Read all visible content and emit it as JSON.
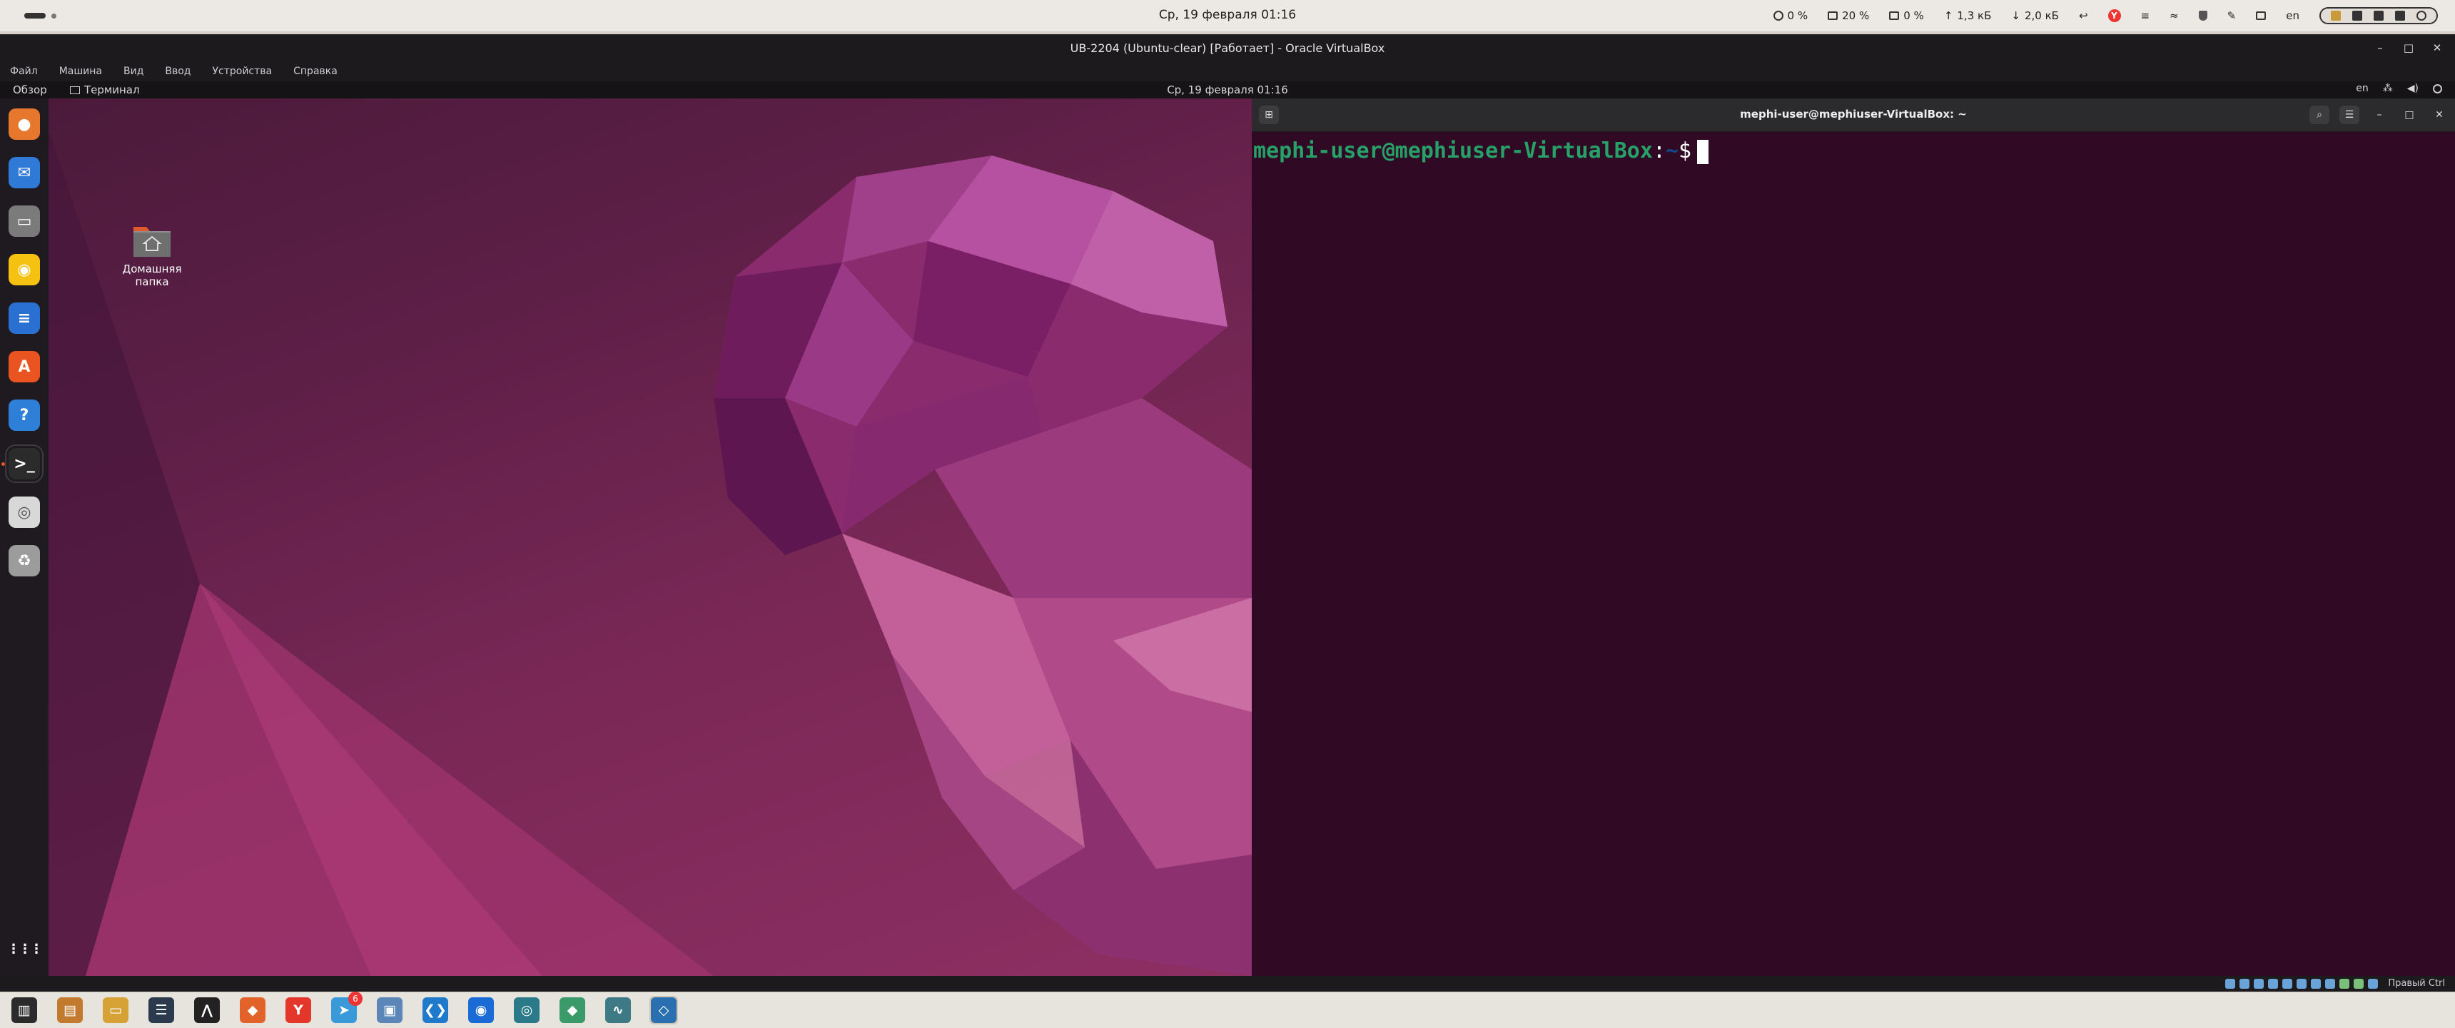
{
  "host": {
    "clock": "Ср, 19 февраля  01:16",
    "tray": {
      "cpu": "0 %",
      "memory": "20 %",
      "swap": "0 %",
      "upload": "1,3 кБ",
      "download": "2,0 кБ",
      "layout": "en",
      "icons": [
        "cpu-icon",
        "memory-icon",
        "swap-icon",
        "upload-arrow-icon",
        "download-arrow-icon",
        "back-arrow-icon",
        "yandex-icon",
        "notes-icon",
        "wifi-icon",
        "shield-icon",
        "pin-icon",
        "clipboard-icon"
      ]
    },
    "status_cluster_icons": [
      "mic-icon",
      "screen-icon",
      "bluetooth-icon",
      "volume-icon",
      "power-icon"
    ],
    "taskbar": [
      {
        "name": "files-icon",
        "color": "#2b2b2b",
        "glyph": "▥"
      },
      {
        "name": "archive-icon",
        "color": "#c17a2e",
        "glyph": "▤"
      },
      {
        "name": "folder-icon",
        "color": "#d6a235",
        "glyph": "▭"
      },
      {
        "name": "notes-app-icon",
        "color": "#2c3a4d",
        "glyph": "☰"
      },
      {
        "name": "terminal-alt-icon",
        "color": "#222222",
        "glyph": "⋀"
      },
      {
        "name": "gitlab-icon",
        "color": "#e2632a",
        "glyph": "◆"
      },
      {
        "name": "yandex-browser-icon",
        "color": "#e4362b",
        "glyph": "Y"
      },
      {
        "name": "telegram-icon",
        "color": "#3a9ad9",
        "glyph": "➤",
        "badge": "6"
      },
      {
        "name": "virtualbox-manager-icon",
        "color": "#5b86b7",
        "glyph": "▣"
      },
      {
        "name": "vscode-icon",
        "color": "#1f7acc",
        "glyph": "❮❯"
      },
      {
        "name": "chat-icon",
        "color": "#1b6bd6",
        "glyph": "◉"
      },
      {
        "name": "mixer-icon",
        "color": "#2a7a8a",
        "glyph": "◎"
      },
      {
        "name": "toolbox-icon",
        "color": "#3a9a6a",
        "glyph": "◆"
      },
      {
        "name": "monitor-icon",
        "color": "#3d7a85",
        "glyph": "∿"
      },
      {
        "name": "virtualbox-vm-icon",
        "color": "#2a6fb0",
        "glyph": "◇",
        "active": true
      }
    ]
  },
  "vbox": {
    "title": "UB-2204 (Ubuntu-clear) [Работает] - Oracle VirtualBox",
    "menu": [
      "Файл",
      "Машина",
      "Вид",
      "Ввод",
      "Устройства",
      "Справка"
    ],
    "hostkey_label": "Правый Ctrl"
  },
  "guest": {
    "overview": "Обзор",
    "active_app": "Терминал",
    "clock": "Ср, 19 февраля  01:16",
    "layout": "en",
    "desktop_icon_label": "Домашняя папка",
    "dock": [
      {
        "name": "firefox-icon",
        "color": "#e8772e",
        "glyph": "●"
      },
      {
        "name": "thunderbird-icon",
        "color": "#2f7ad7",
        "glyph": "✉"
      },
      {
        "name": "files-icon",
        "color": "#7b7b7b",
        "glyph": "▭"
      },
      {
        "name": "rhythmbox-icon",
        "color": "#f5c211",
        "glyph": "◉"
      },
      {
        "name": "writer-icon",
        "color": "#2a6fd2",
        "glyph": "≡"
      },
      {
        "name": "software-center-icon",
        "color": "#e95420",
        "glyph": "A"
      },
      {
        "name": "help-icon",
        "color": "#2d7fd7",
        "glyph": "?"
      },
      {
        "name": "terminal-icon",
        "color": "#2b2b2b",
        "glyph": ">_",
        "active": true
      },
      {
        "name": "disc-icon",
        "color": "#d8d8d8",
        "glyph": "◎"
      },
      {
        "name": "trash-icon",
        "color": "#9c9c9c",
        "glyph": "♻"
      },
      {
        "name": "app-grid-icon",
        "color": "#1e1a1f",
        "glyph": "⋮⋮⋮"
      }
    ]
  },
  "terminal": {
    "title": "mephi-user@mephiuser-VirtualBox: ~",
    "prompt_user": "mephi-user@mephiuser-VirtualBox",
    "prompt_sep": ":",
    "prompt_path": "~",
    "prompt_dollar": "$"
  }
}
